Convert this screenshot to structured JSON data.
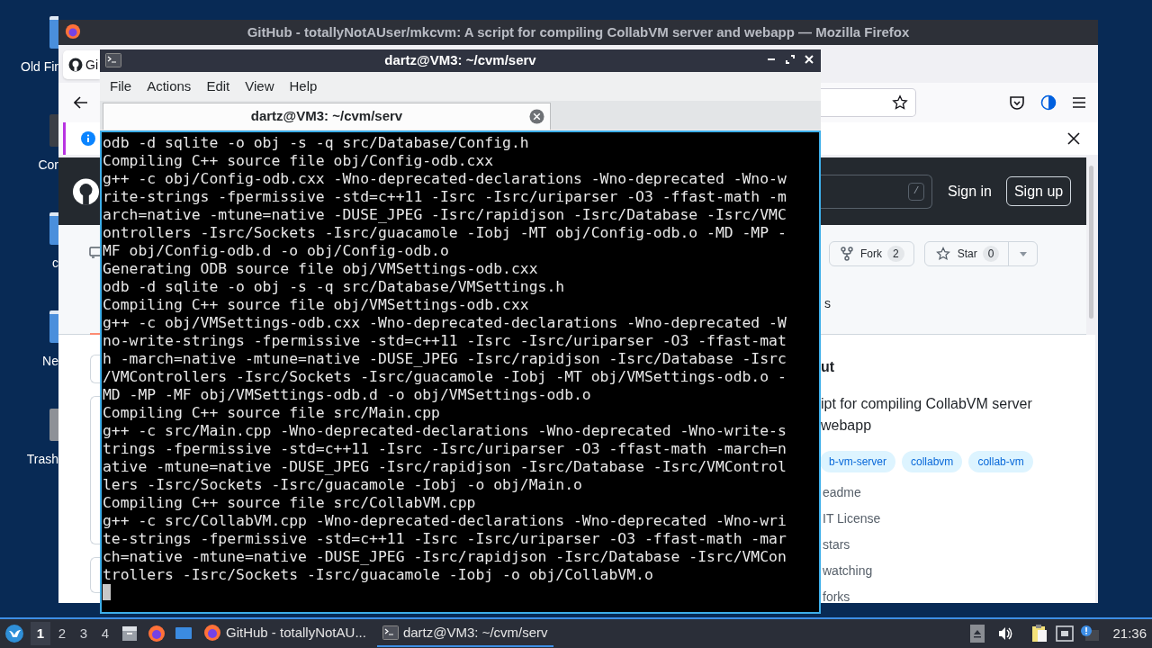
{
  "desktop_icons": [
    {
      "label": "Old Fir",
      "kind": "file"
    },
    {
      "label": "Cor",
      "kind": "computer"
    },
    {
      "label": "c",
      "kind": "file"
    },
    {
      "label": "Ne",
      "kind": "file"
    },
    {
      "label": "Trash",
      "kind": "trash"
    }
  ],
  "browser": {
    "title": "GitHub - totallyNotAUser/mkcvm: A script for compiling CollabVM server and webapp — Mozilla Firefox",
    "tab_label": "Gi",
    "header": {
      "search_key": "/",
      "sign_in": "Sign in",
      "sign_up": "Sign up"
    },
    "repo_buttons": [
      {
        "label": "Fork",
        "count": "2",
        "kind": "fork"
      },
      {
        "label": "Star",
        "count": "0",
        "kind": "star"
      }
    ],
    "nav_fragment": "s",
    "about": {
      "heading": "ut",
      "description": "ipt for compiling CollabVM server",
      "description_2": "webapp",
      "topics": [
        "b-vm-server",
        "collabvm",
        "collab-vm"
      ],
      "facts": [
        "eadme",
        "IT License",
        "stars",
        "watching",
        "forks"
      ]
    }
  },
  "terminal": {
    "title": "dartz@VM3: ~/cvm/serv",
    "menu": [
      "File",
      "Actions",
      "Edit",
      "View",
      "Help"
    ],
    "tabs": [
      {
        "label": "dartz@VM3: ~/cvm/serv",
        "selected": true
      }
    ],
    "lines": [
      "odb -d sqlite -o obj -s -q src/Database/Config.h",
      "Compiling C++ source file obj/Config-odb.cxx",
      "g++ -c obj/Config-odb.cxx -Wno-deprecated-declarations -Wno-deprecated -Wno-w",
      "rite-strings -fpermissive -std=c++11 -Isrc -Isrc/uriparser -O3 -ffast-math -m",
      "arch=native -mtune=native -DUSE_JPEG -Isrc/rapidjson -Isrc/Database -Isrc/VMC",
      "ontrollers -Isrc/Sockets -Isrc/guacamole -Iobj -MT obj/Config-odb.o -MD -MP -",
      "MF obj/Config-odb.d -o obj/Config-odb.o",
      "Generating ODB source file obj/VMSettings-odb.cxx",
      "odb -d sqlite -o obj -s -q src/Database/VMSettings.h",
      "Compiling C++ source file obj/VMSettings-odb.cxx",
      "g++ -c obj/VMSettings-odb.cxx -Wno-deprecated-declarations -Wno-deprecated -W",
      "no-write-strings -fpermissive -std=c++11 -Isrc -Isrc/uriparser -O3 -ffast-mat",
      "h -march=native -mtune=native -DUSE_JPEG -Isrc/rapidjson -Isrc/Database -Isrc",
      "/VMControllers -Isrc/Sockets -Isrc/guacamole -Iobj -MT obj/VMSettings-odb.o -",
      "MD -MP -MF obj/VMSettings-odb.d -o obj/VMSettings-odb.o",
      "Compiling C++ source file src/Main.cpp",
      "g++ -c src/Main.cpp -Wno-deprecated-declarations -Wno-deprecated -Wno-write-s",
      "trings -fpermissive -std=c++11 -Isrc -Isrc/uriparser -O3 -ffast-math -march=n",
      "ative -mtune=native -DUSE_JPEG -Isrc/rapidjson -Isrc/Database -Isrc/VMControl",
      "lers -Isrc/Sockets -Isrc/guacamole -Iobj -o obj/Main.o",
      "Compiling C++ source file src/CollabVM.cpp",
      "g++ -c src/CollabVM.cpp -Wno-deprecated-declarations -Wno-deprecated -Wno-wri",
      "te-strings -fpermissive -std=c++11 -Isrc -Isrc/uriparser -O3 -ffast-math -mar",
      "ch=native -mtune=native -DUSE_JPEG -Isrc/rapidjson -Isrc/Database -Isrc/VMCon",
      "trollers -Isrc/Sockets -Isrc/guacamole -Iobj -o obj/CollabVM.o"
    ]
  },
  "taskbar": {
    "workspaces": [
      {
        "label": "1",
        "selected": true
      },
      {
        "label": "2",
        "selected": false
      },
      {
        "label": "3",
        "selected": false
      },
      {
        "label": "4",
        "selected": false
      }
    ],
    "tasks": [
      {
        "label": "GitHub - totallyNotAU...",
        "kind": "browser",
        "selected": false
      },
      {
        "label": "dartz@VM3: ~/cvm/serv",
        "kind": "terminal",
        "selected": true
      }
    ],
    "clock": "21:36"
  }
}
